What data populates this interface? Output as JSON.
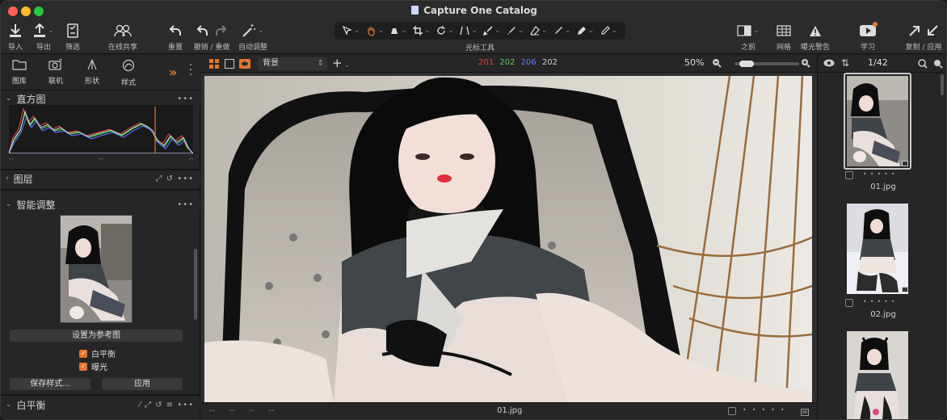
{
  "window": {
    "title": "Capture One Catalog",
    "traffic_colors": [
      "#fe5f57",
      "#febc2e",
      "#28c840"
    ]
  },
  "toolbar": {
    "import": "导入",
    "export": "导出",
    "filter": "筛选",
    "share": "在线共享",
    "reset": "重置",
    "undo_redo": "撤销 / 重做",
    "auto_adjust": "自动调整",
    "cursor_tools": "光标工具",
    "before": "之前",
    "grid": "网格",
    "exposure_warning": "曝光警告",
    "learn": "学习",
    "copy_apply": "复制 / 应用"
  },
  "tool_tabs": {
    "library": "图库",
    "tethered": "联机",
    "shape": "形状",
    "style": "样式"
  },
  "panels": {
    "histogram": "直方图",
    "histogram_values": [
      "--",
      "--",
      "--"
    ],
    "layers": "图层",
    "smart_adjust": "智能调整",
    "set_reference": "设置为参考图",
    "white_balance_check": "白平衡",
    "exposure_check": "曝光",
    "save_style": "保存样式...",
    "apply": "应用",
    "white_balance": "白平衡"
  },
  "viewer": {
    "layer_select": "背景",
    "rgb": {
      "r": "201",
      "g": "202",
      "b": "206",
      "l": "202"
    },
    "rgb_colors": {
      "r": "#e04343",
      "g": "#5fcf5f",
      "b": "#6a7bff",
      "l": "#cfcfcf"
    },
    "zoom": "50%",
    "filename": "01.jpg",
    "foot_values": [
      "--",
      "--",
      "--",
      "--"
    ],
    "zoom_fraction": 0.1
  },
  "browser": {
    "counter": "1/42",
    "items": [
      {
        "name": "01.jpg"
      },
      {
        "name": "02.jpg"
      },
      {
        "name": ""
      }
    ]
  },
  "colors": {
    "accent": "#e8742e",
    "panel_bg": "#262626",
    "toolbar_bg": "#2b2b2b"
  }
}
